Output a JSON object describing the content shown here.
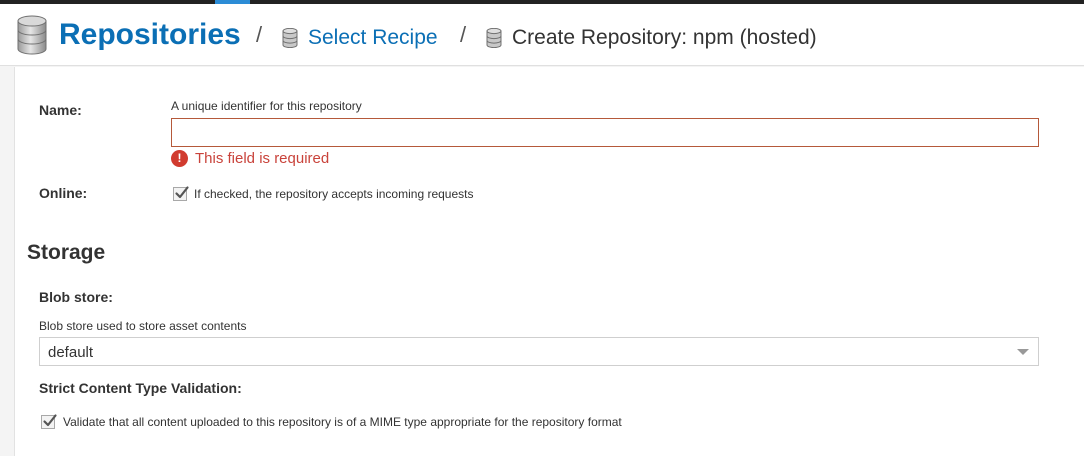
{
  "breadcrumb": {
    "root": "Repositories",
    "separator": "/",
    "link": "Select Recipe",
    "current": "Create Repository: npm (hosted)"
  },
  "form": {
    "name": {
      "label": "Name:",
      "help": "A unique identifier for this repository",
      "value": "",
      "error": "This field is required"
    },
    "online": {
      "label": "Online:",
      "checked": true,
      "help": "If checked, the repository accepts incoming requests"
    }
  },
  "storage": {
    "title": "Storage",
    "blob_store": {
      "label": "Blob store:",
      "help": "Blob store used to store asset contents",
      "selected": "default"
    },
    "strict_content": {
      "label": "Strict Content Type Validation:",
      "checked": true,
      "help": "Validate that all content uploaded to this repository is of a MIME type appropriate for the repository format"
    }
  },
  "icons": {
    "breadcrumb": "database-icon",
    "error": "exclamation-circle-icon",
    "check": "checkmark-icon",
    "dropdown": "caret-down-icon"
  },
  "colors": {
    "link": "#0b6fb5",
    "error": "#c9433b",
    "error_border": "#b5593a"
  }
}
